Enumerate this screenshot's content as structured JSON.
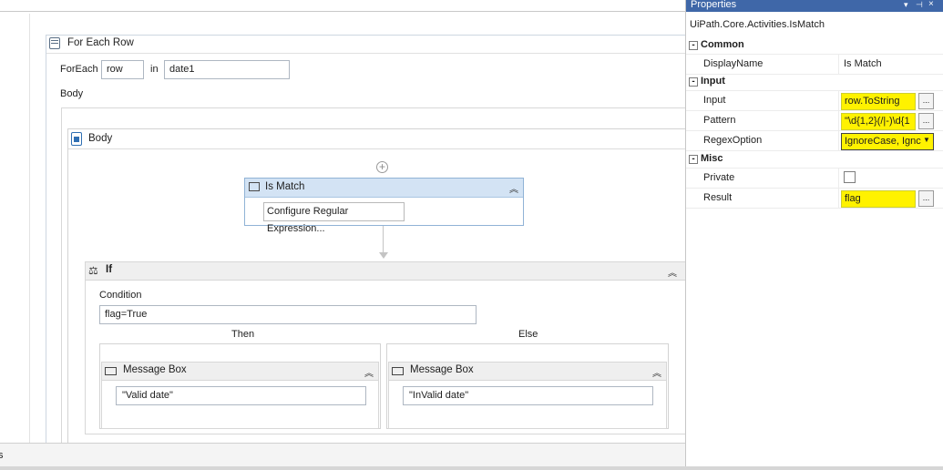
{
  "designer": {
    "foreach": {
      "title": "For Each Row",
      "foreach_label": "ForEach",
      "item_value": "row",
      "in_label": "in",
      "collection_value": "date1",
      "body_label": "Body"
    },
    "sequence": {
      "title": "Body"
    },
    "is_match": {
      "title": "Is Match",
      "configure_button": "Configure Regular Expression..."
    },
    "if_activity": {
      "title": "If",
      "condition_label": "Condition",
      "condition_value": "flag=True",
      "then_label": "Then",
      "else_label": "Else"
    },
    "then_message": {
      "title": "Message Box",
      "text_value": "\"Valid date\""
    },
    "else_message": {
      "title": "Message Box",
      "text_value": "\"InValid date\""
    }
  },
  "status_bar": {
    "text": "s"
  },
  "properties": {
    "title": "Properties",
    "activity_type": "UiPath.Core.Activities.IsMatch",
    "categories": {
      "common": "Common",
      "input": "Input",
      "misc": "Misc"
    },
    "rows": {
      "displayname": {
        "name": "DisplayName",
        "value": "Is Match"
      },
      "input": {
        "name": "Input",
        "value": "row.ToString"
      },
      "pattern": {
        "name": "Pattern",
        "value": "\"\\d{1,2}(/|-)\\d{1"
      },
      "regexoption": {
        "name": "RegexOption",
        "value": "IgnoreCase, Ignc"
      },
      "private": {
        "name": "Private",
        "checked": false
      },
      "result": {
        "name": "Result",
        "value": "flag"
      }
    },
    "ellipsis": "...",
    "highlight_color": "#fff200"
  }
}
